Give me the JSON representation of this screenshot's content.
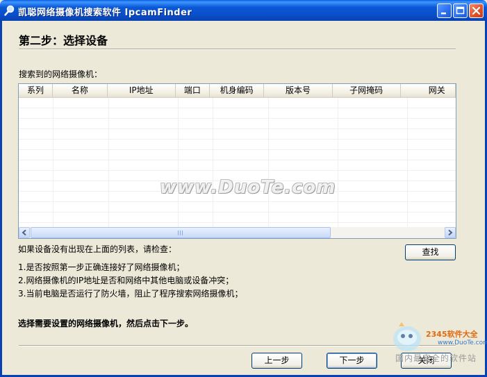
{
  "window": {
    "title": "凯聪网络摄像机搜索软件 IpcamFinder"
  },
  "step": {
    "title": "第二步：选择设备"
  },
  "device_list": {
    "label": "搜索到的网络摄像机：",
    "columns": [
      "系列",
      "名称",
      "IP地址",
      "端口",
      "机身编码",
      "版本号",
      "子网掩码",
      "网关"
    ],
    "rows": []
  },
  "hints": {
    "title": "如果设备没有出现在上面的列表，请检查：",
    "items": [
      "1.是否按照第一步正确连接好了网络摄像机；",
      "2.网络摄像机的IP地址是否和网络中其他电脑或设备冲突；",
      "3.当前电脑是否运行了防火墙，阻止了程序搜索网络摄像机；"
    ]
  },
  "instruction": "选择需要设置的网络摄像机，然后点击下一步。",
  "buttons": {
    "search": "查找",
    "prev": "上一步",
    "next": "下一步",
    "close": "关闭"
  },
  "watermark": "www.DuoTe.com",
  "logo": {
    "brand": "2345软件大全",
    "url": "www.DuoTe.com",
    "tagline": "国内最安全的软件站"
  }
}
